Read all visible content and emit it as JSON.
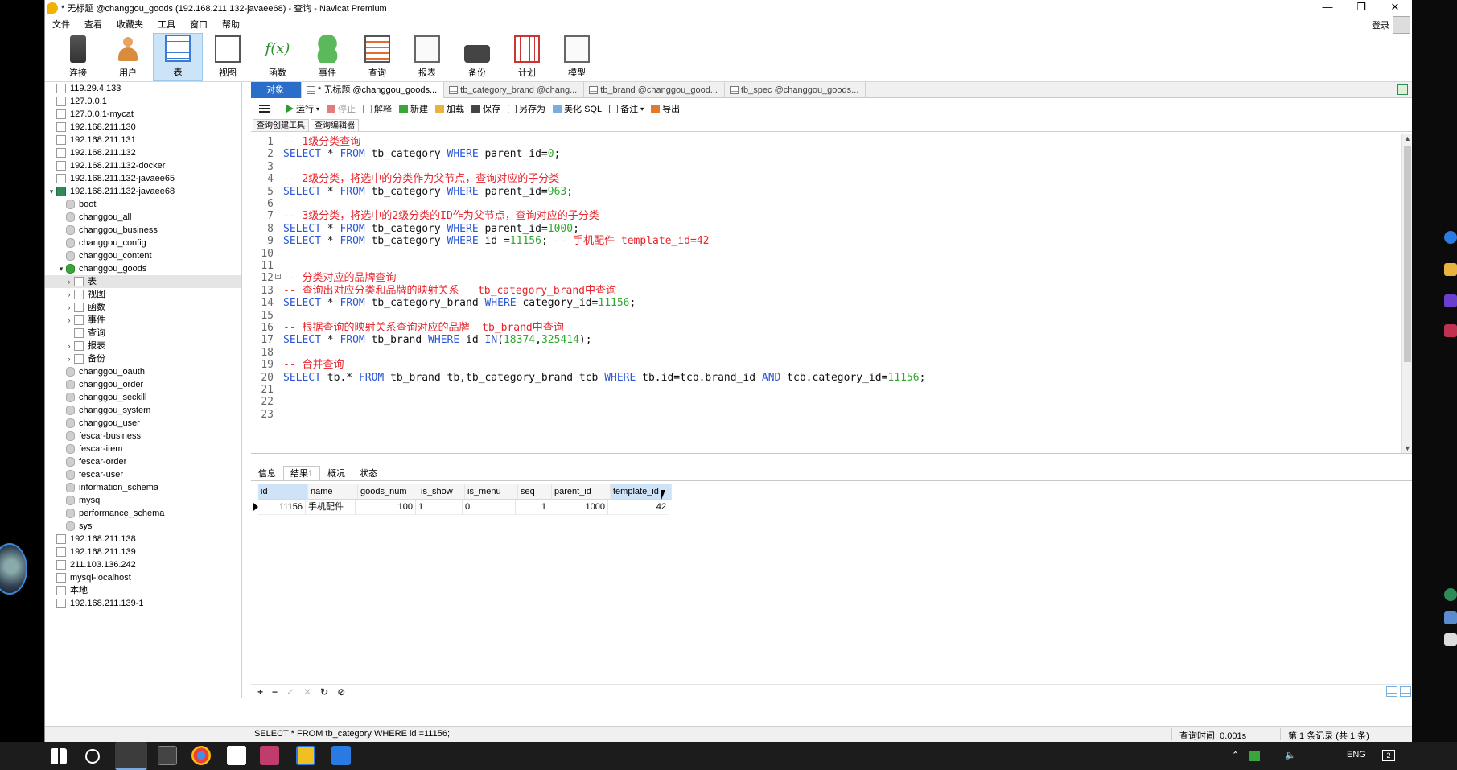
{
  "window": {
    "title": "* 无标题 @changgou_goods (192.168.211.132-javaee68) - 查询 - Navicat Premium",
    "controls": [
      "—",
      "❐",
      "✕"
    ]
  },
  "menubar": {
    "items": [
      "文件",
      "查看",
      "收藏夹",
      "工具",
      "窗口",
      "帮助"
    ],
    "login": "登录"
  },
  "toolbar": {
    "buttons": [
      {
        "label": "连接",
        "icon": "plug-icon"
      },
      {
        "label": "用户",
        "icon": "user-icon"
      },
      {
        "label": "表",
        "icon": "table-icon"
      },
      {
        "label": "视图",
        "icon": "view-icon"
      },
      {
        "label": "函数",
        "icon": "function-icon"
      },
      {
        "label": "事件",
        "icon": "event-icon"
      },
      {
        "label": "查询",
        "icon": "query-icon"
      },
      {
        "label": "报表",
        "icon": "report-icon"
      },
      {
        "label": "备份",
        "icon": "backup-icon"
      },
      {
        "label": "计划",
        "icon": "schedule-icon"
      },
      {
        "label": "模型",
        "icon": "model-icon"
      }
    ],
    "active_index": 2
  },
  "tree": {
    "rows": [
      {
        "label": "119.29.4.133",
        "indent": 0,
        "kind": "conn"
      },
      {
        "label": "127.0.0.1",
        "indent": 0,
        "kind": "conn"
      },
      {
        "label": "127.0.0.1-mycat",
        "indent": 0,
        "kind": "conn"
      },
      {
        "label": "192.168.211.130",
        "indent": 0,
        "kind": "conn"
      },
      {
        "label": "192.168.211.131",
        "indent": 0,
        "kind": "conn"
      },
      {
        "label": "192.168.211.132",
        "indent": 0,
        "kind": "conn"
      },
      {
        "label": "192.168.211.132-docker",
        "indent": 0,
        "kind": "conn"
      },
      {
        "label": "192.168.211.132-javaee65",
        "indent": 0,
        "kind": "conn"
      },
      {
        "label": "192.168.211.132-javaee68",
        "indent": 0,
        "kind": "conn-on",
        "arrow": "▾"
      },
      {
        "label": "boot",
        "indent": 1,
        "kind": "db"
      },
      {
        "label": "changgou_all",
        "indent": 1,
        "kind": "db"
      },
      {
        "label": "changgou_business",
        "indent": 1,
        "kind": "db"
      },
      {
        "label": "changgou_config",
        "indent": 1,
        "kind": "db"
      },
      {
        "label": "changgou_content",
        "indent": 1,
        "kind": "db"
      },
      {
        "label": "changgou_goods",
        "indent": 1,
        "kind": "db-on",
        "arrow": "▾"
      },
      {
        "label": "表",
        "indent": 2,
        "kind": "folder",
        "arrow": "›",
        "selected": true
      },
      {
        "label": "视图",
        "indent": 2,
        "kind": "folder",
        "arrow": "›"
      },
      {
        "label": "函数",
        "indent": 2,
        "kind": "folder",
        "arrow": "›"
      },
      {
        "label": "事件",
        "indent": 2,
        "kind": "folder",
        "arrow": "›"
      },
      {
        "label": "查询",
        "indent": 2,
        "kind": "folder"
      },
      {
        "label": "报表",
        "indent": 2,
        "kind": "folder",
        "arrow": "›"
      },
      {
        "label": "备份",
        "indent": 2,
        "kind": "folder",
        "arrow": "›"
      },
      {
        "label": "changgou_oauth",
        "indent": 1,
        "kind": "db"
      },
      {
        "label": "changgou_order",
        "indent": 1,
        "kind": "db"
      },
      {
        "label": "changgou_seckill",
        "indent": 1,
        "kind": "db"
      },
      {
        "label": "changgou_system",
        "indent": 1,
        "kind": "db"
      },
      {
        "label": "changgou_user",
        "indent": 1,
        "kind": "db"
      },
      {
        "label": "fescar-business",
        "indent": 1,
        "kind": "db"
      },
      {
        "label": "fescar-item",
        "indent": 1,
        "kind": "db"
      },
      {
        "label": "fescar-order",
        "indent": 1,
        "kind": "db"
      },
      {
        "label": "fescar-user",
        "indent": 1,
        "kind": "db"
      },
      {
        "label": "information_schema",
        "indent": 1,
        "kind": "db"
      },
      {
        "label": "mysql",
        "indent": 1,
        "kind": "db"
      },
      {
        "label": "performance_schema",
        "indent": 1,
        "kind": "db"
      },
      {
        "label": "sys",
        "indent": 1,
        "kind": "db"
      },
      {
        "label": "192.168.211.138",
        "indent": 0,
        "kind": "conn"
      },
      {
        "label": "192.168.211.139",
        "indent": 0,
        "kind": "conn"
      },
      {
        "label": "211.103.136.242",
        "indent": 0,
        "kind": "conn"
      },
      {
        "label": "mysql-localhost",
        "indent": 0,
        "kind": "conn"
      },
      {
        "label": "本地",
        "indent": 0,
        "kind": "conn"
      },
      {
        "label": "192.168.211.139-1",
        "indent": 0,
        "kind": "conn"
      }
    ]
  },
  "doctabs": [
    {
      "label": "对象",
      "kind": "obj"
    },
    {
      "label": "* 无标题 @changgou_goods...",
      "kind": "active"
    },
    {
      "label": "tb_category_brand @chang...",
      "kind": "normal"
    },
    {
      "label": "tb_brand @changgou_good...",
      "kind": "normal"
    },
    {
      "label": "tb_spec @changgou_goods...",
      "kind": "normal"
    }
  ],
  "query_toolbar": {
    "run": "运行",
    "stop": "停止",
    "explain": "解释",
    "new": "新建",
    "load": "加载",
    "save": "保存",
    "saveas": "另存为",
    "beautify": "美化 SQL",
    "memo": "备注",
    "export": "导出"
  },
  "subtabs": [
    "查询创建工具",
    "查询编辑器"
  ],
  "editor": {
    "lines": [
      {
        "n": "1",
        "parts": [
          [
            "c",
            "-- 1级分类查询"
          ]
        ]
      },
      {
        "n": "2",
        "parts": [
          [
            "k",
            "SELECT"
          ],
          [
            "p",
            " * "
          ],
          [
            "k",
            "FROM"
          ],
          [
            "p",
            " tb_category "
          ],
          [
            "k",
            "WHERE"
          ],
          [
            "p",
            " parent_id="
          ],
          [
            "n",
            "0"
          ],
          [
            "p",
            ";"
          ]
        ]
      },
      {
        "n": "3",
        "parts": []
      },
      {
        "n": "4",
        "parts": [
          [
            "c",
            "-- 2级分类，将选中的分类作为父节点，查询对应的子分类"
          ]
        ]
      },
      {
        "n": "5",
        "parts": [
          [
            "k",
            "SELECT"
          ],
          [
            "p",
            " * "
          ],
          [
            "k",
            "FROM"
          ],
          [
            "p",
            " tb_category "
          ],
          [
            "k",
            "WHERE"
          ],
          [
            "p",
            " parent_id="
          ],
          [
            "n",
            "963"
          ],
          [
            "p",
            ";"
          ]
        ]
      },
      {
        "n": "6",
        "parts": []
      },
      {
        "n": "7",
        "parts": [
          [
            "c",
            "-- 3级分类，将选中的2级分类的ID作为父节点，查询对应的子分类"
          ]
        ]
      },
      {
        "n": "8",
        "parts": [
          [
            "k",
            "SELECT"
          ],
          [
            "p",
            " * "
          ],
          [
            "k",
            "FROM"
          ],
          [
            "p",
            " tb_category "
          ],
          [
            "k",
            "WHERE"
          ],
          [
            "p",
            " parent_id="
          ],
          [
            "n",
            "1000"
          ],
          [
            "p",
            ";"
          ]
        ]
      },
      {
        "n": "9",
        "parts": [
          [
            "k",
            "SELECT"
          ],
          [
            "p",
            " * "
          ],
          [
            "k",
            "FROM"
          ],
          [
            "p",
            " tb_category "
          ],
          [
            "k",
            "WHERE"
          ],
          [
            "p",
            " id ="
          ],
          [
            "n",
            "11156"
          ],
          [
            "p",
            "; "
          ],
          [
            "c",
            "-- 手机配件 template_id=42"
          ]
        ]
      },
      {
        "n": "10",
        "parts": []
      },
      {
        "n": "11",
        "parts": []
      },
      {
        "n": "12",
        "parts": [
          [
            "c",
            "-- 分类对应的品牌查询"
          ]
        ],
        "fold": true
      },
      {
        "n": "13",
        "parts": [
          [
            "c",
            "-- 查询出对应分类和品牌的映射关系   tb_category_brand中查询"
          ]
        ]
      },
      {
        "n": "14",
        "parts": [
          [
            "k",
            "SELECT"
          ],
          [
            "p",
            " * "
          ],
          [
            "k",
            "FROM"
          ],
          [
            "p",
            " tb_category_brand "
          ],
          [
            "k",
            "WHERE"
          ],
          [
            "p",
            " category_id="
          ],
          [
            "n",
            "11156"
          ],
          [
            "p",
            ";"
          ]
        ]
      },
      {
        "n": "15",
        "parts": []
      },
      {
        "n": "16",
        "parts": [
          [
            "c",
            "-- 根据查询的映射关系查询对应的品牌  tb_brand中查询"
          ]
        ]
      },
      {
        "n": "17",
        "parts": [
          [
            "k",
            "SELECT"
          ],
          [
            "p",
            " * "
          ],
          [
            "k",
            "FROM"
          ],
          [
            "p",
            " tb_brand "
          ],
          [
            "k",
            "WHERE"
          ],
          [
            "p",
            " id "
          ],
          [
            "k",
            "IN"
          ],
          [
            "p",
            "("
          ],
          [
            "n",
            "18374"
          ],
          [
            "p",
            ","
          ],
          [
            "n",
            "325414"
          ],
          [
            "p",
            ");"
          ]
        ]
      },
      {
        "n": "18",
        "parts": []
      },
      {
        "n": "19",
        "parts": [
          [
            "c",
            "-- 合并查询"
          ]
        ]
      },
      {
        "n": "20",
        "parts": [
          [
            "k",
            "SELECT"
          ],
          [
            "p",
            " tb.* "
          ],
          [
            "k",
            "FROM"
          ],
          [
            "p",
            " tb_brand tb,tb_category_brand tcb "
          ],
          [
            "k",
            "WHERE"
          ],
          [
            "p",
            " tb.id=tcb.brand_id "
          ],
          [
            "k",
            "AND"
          ],
          [
            "p",
            " tcb.category_id="
          ],
          [
            "n",
            "11156"
          ],
          [
            "p",
            ";"
          ]
        ]
      },
      {
        "n": "21",
        "parts": []
      },
      {
        "n": "22",
        "parts": []
      },
      {
        "n": "23",
        "parts": []
      }
    ]
  },
  "result_tabs": [
    "信息",
    "结果1",
    "概况",
    "状态"
  ],
  "result_active": 1,
  "grid": {
    "columns": [
      "id",
      "name",
      "goods_num",
      "is_show",
      "is_menu",
      "seq",
      "parent_id",
      "template_id"
    ],
    "rows": [
      [
        "11156",
        "手机配件",
        "100",
        "1",
        "0",
        "1",
        "1000",
        "42"
      ]
    ],
    "numeric": [
      true,
      false,
      true,
      false,
      false,
      true,
      true,
      true
    ],
    "highlight_header": 7
  },
  "gridbar": [
    "+",
    "−",
    "✓",
    "✕",
    "↻",
    "⊘"
  ],
  "statusbar": {
    "sql": "SELECT * FROM tb_category WHERE id =11156;",
    "query_time": "查询时间: 0.001s",
    "record": "第 1 条记录 (共 1 条)"
  },
  "taskbar": {
    "tray_lang": "ENG",
    "notification_count": "2"
  },
  "colors": {
    "accent": "#2b6ec9",
    "comment": "#e8242c",
    "keyword": "#2a56d8",
    "number": "#2fa72f"
  }
}
